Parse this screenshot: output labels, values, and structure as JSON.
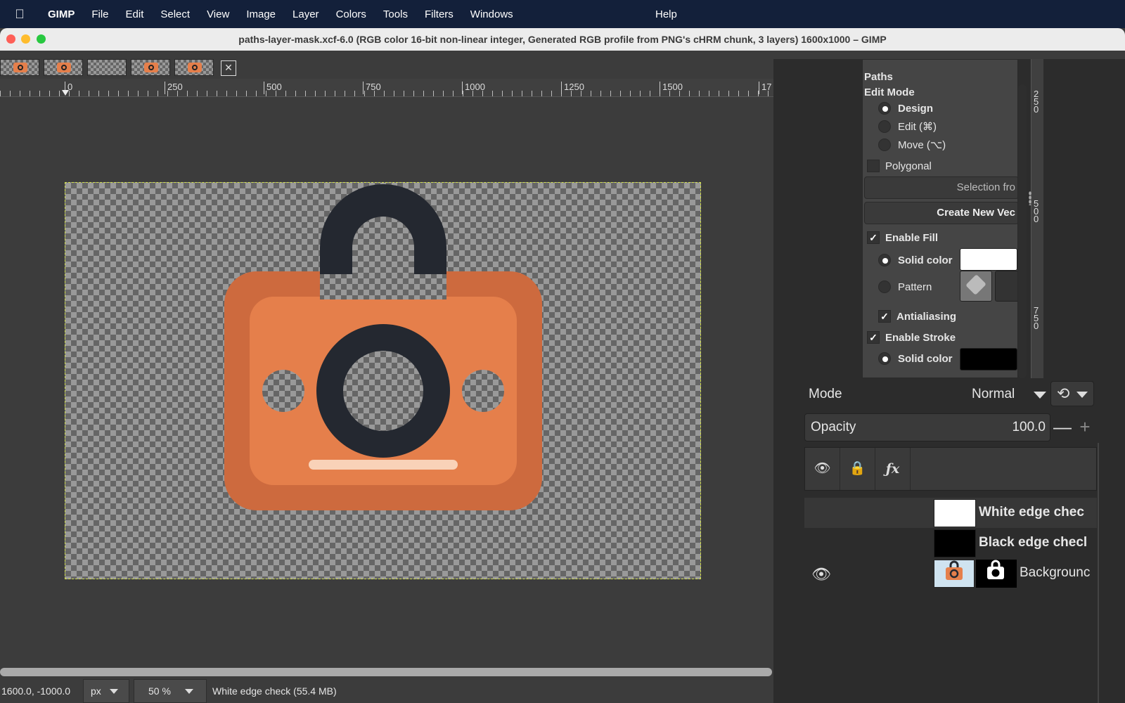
{
  "menubar": {
    "app": "GIMP",
    "items": [
      "File",
      "Edit",
      "Select",
      "View",
      "Image",
      "Layer",
      "Colors",
      "Tools",
      "Filters",
      "Windows"
    ],
    "help": "Help"
  },
  "window": {
    "title": "paths-layer-mask.xcf-6.0 (RGB color 16-bit non-linear integer, Generated RGB profile from PNG's cHRM chunk, 3 layers) 1600x1000 – GIMP"
  },
  "ruler": {
    "labels": [
      "0",
      "250",
      "500",
      "750",
      "1000",
      "1250",
      "1500",
      "17"
    ]
  },
  "statusbar": {
    "coords": "1600.0, -1000.0",
    "unit": "px",
    "zoom": "50 %",
    "message": "White edge check (55.4 MB)"
  },
  "tool_options": {
    "title": "Paths",
    "edit_mode_label": "Edit Mode",
    "modes": [
      "Design",
      "Edit (⌘)",
      "Move (⌥)"
    ],
    "selected_mode": "Design",
    "polygonal": "Polygonal",
    "selection_from_path": "Selection fro",
    "create_new_vector": "Create New Vec",
    "enable_fill": "Enable Fill",
    "fill_solid": "Solid color",
    "fill_pattern": "Pattern",
    "antialiasing": "Antialiasing",
    "enable_stroke": "Enable Stroke",
    "stroke_solid": "Solid color",
    "fill_color": "#ffffff",
    "stroke_color": "#000000"
  },
  "side_ruler": {
    "labels": [
      "250",
      "500",
      "750"
    ]
  },
  "layers": {
    "mode_label": "Mode",
    "mode_value": "Normal",
    "opacity_label": "Opacity",
    "opacity_value": "100.0",
    "header_icons": [
      "eye-icon",
      "lock-icon",
      "fx-icon"
    ],
    "fx_label": "ƒx",
    "rows": [
      {
        "name": "White edge chec",
        "visible": false
      },
      {
        "name": "Black edge checl",
        "visible": false
      },
      {
        "name": "Backgrounc",
        "visible": true
      }
    ]
  },
  "colors": {
    "camera_outer": "#cd6a3e",
    "camera_inner": "#e57f4b",
    "camera_dark": "#242830",
    "camera_bar": "#f9d2b8",
    "selection_border": "#d2e04a"
  }
}
